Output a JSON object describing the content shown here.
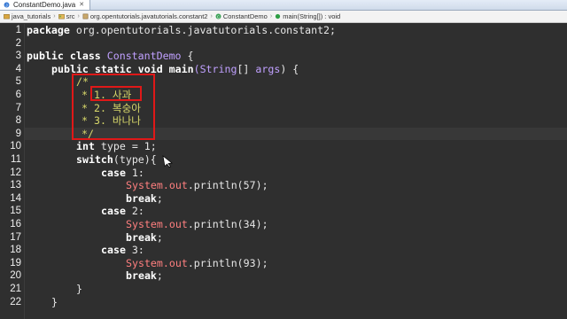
{
  "tab": {
    "title": "ConstantDemo.java"
  },
  "breadcrumb": [
    "java_tutorials",
    "src",
    "org.opentutorials.javatutorials.constant2",
    "ConstantDemo",
    "main(String[]) : void"
  ],
  "editor": {
    "line_numbers": [
      "1",
      "2",
      "3",
      "4",
      "5",
      "6",
      "7",
      "8",
      "9",
      "10",
      "11",
      "12",
      "13",
      "14",
      "15",
      "16",
      "17",
      "18",
      "19",
      "20",
      "21",
      "22"
    ],
    "lines": {
      "l1a": "package",
      "l1b": " org.opentutorials.javatutorials.constant2;",
      "l3a": "public",
      "l3b": " ",
      "l3c": "class",
      "l3d": " ",
      "l3e": "ConstantDemo",
      "l3f": " {",
      "l4a": "public",
      "l4b": "static",
      "l4c": "void",
      "l4d": "main",
      "l4e": "(",
      "l4f": "String",
      "l4g": "[] ",
      "l4h": "args",
      "l4i": ") {",
      "l5": "/*",
      "l6": "* 1. 사과",
      "l7": "* 2. 복숭아",
      "l8": "* 3. 바나나",
      "l9": "*/",
      "l10a": "int",
      "l10b": " type = 1;",
      "l11a": "switch",
      "l11b": "(type){",
      "l12a": "case",
      "l12b": " 1:",
      "l13a": "System.",
      "l13b": "out",
      "l13c": ".println(57);",
      "l14a": "break",
      "l14b": ";",
      "l15a": "case",
      "l15b": " 2:",
      "l16a": "System.",
      "l16b": "out",
      "l16c": ".println(34);",
      "l17a": "break",
      "l17b": ";",
      "l18a": "case",
      "l18b": " 3:",
      "l19a": "System.",
      "l19b": "out",
      "l19c": ".println(93);",
      "l20a": "break",
      "l20b": ";",
      "l21": "}",
      "l22": "}"
    }
  },
  "colors": {
    "background": "#2f2f2f",
    "keyword": "#ffffff",
    "comment": "#d8d86a",
    "system_out": "#ff7f7f",
    "annotation_box": "#e01818"
  }
}
